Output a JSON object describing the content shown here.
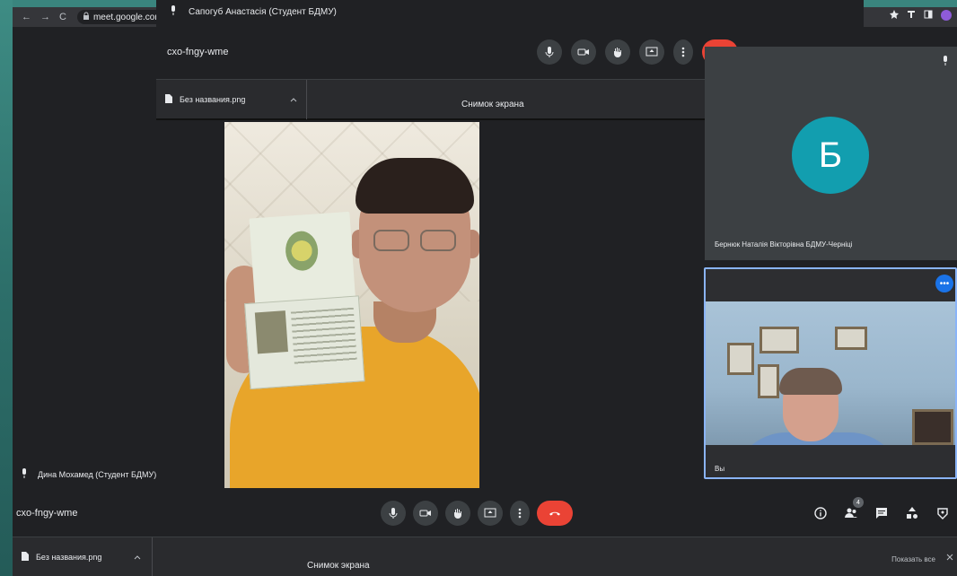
{
  "browser": {
    "url": "meet.google.com",
    "nav_back": "←",
    "nav_forward": "→",
    "nav_reload": "C"
  },
  "overlay": {
    "presenter_name": "Сапогуб Анастасія (Студент БДМУ)",
    "meeting_code": "cxo-fngy-wme",
    "file_name": "Без названия.png",
    "screen_title": "Снимок экрана"
  },
  "main_video": {
    "participant_name": "Дина Мохамед (Студент БДМУ)"
  },
  "tiles": {
    "avatar_letter": "Б",
    "top_name": "Бернюк Наталія Вікторівна БДМУ-Черніці",
    "bottom_name": "Вы"
  },
  "toolbar": {
    "meeting_code": "cxo-fngy-wme",
    "participant_count": "4"
  },
  "downloads": {
    "file_name": "Без названия.png",
    "screen_title": "Снимок экрана",
    "show_all": "Показать все"
  },
  "colors": {
    "end_call": "#ea4335",
    "avatar_bg": "#129eaf",
    "highlight": "#8ab4f8",
    "background": "#202124"
  }
}
